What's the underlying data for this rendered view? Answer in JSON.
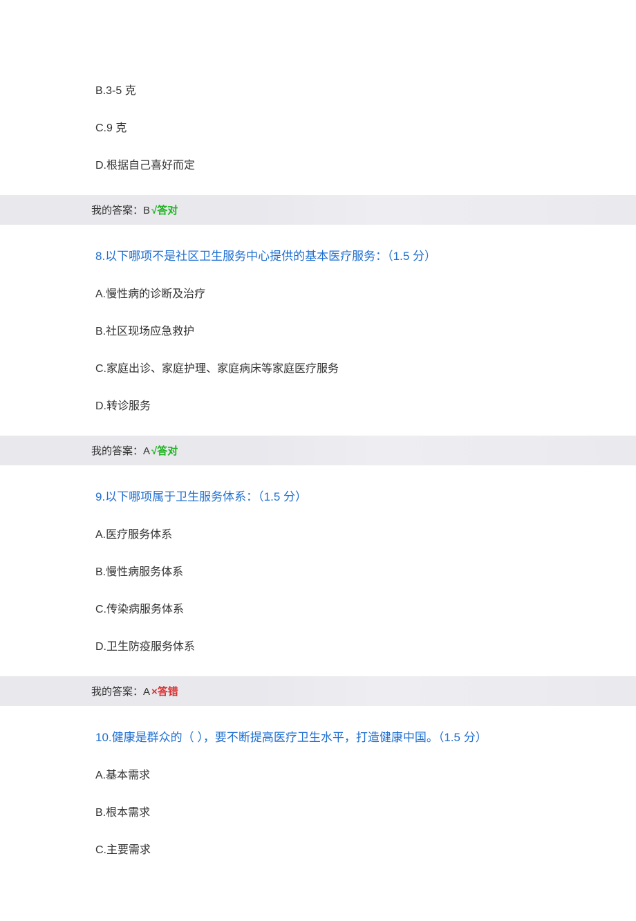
{
  "q7_partial": {
    "options": [
      {
        "label": "B.3-5 克"
      },
      {
        "label": "C.9 克"
      },
      {
        "label": "D.根据自己喜好而定"
      }
    ],
    "answer_prefix": "我的答案：B ",
    "answer_mark": "√答对"
  },
  "q8": {
    "title": "8.以下哪项不是社区卫生服务中心提供的基本医疗服务：（1.5 分）",
    "options": [
      {
        "label": "A.慢性病的诊断及治疗"
      },
      {
        "label": "B.社区现场应急救护"
      },
      {
        "label": "C.家庭出诊、家庭护理、家庭病床等家庭医疗服务"
      },
      {
        "label": "D.转诊服务"
      }
    ],
    "answer_prefix": "我的答案：A ",
    "answer_mark": "√答对"
  },
  "q9": {
    "title": "9.以下哪项属于卫生服务体系：（1.5 分）",
    "options": [
      {
        "label": "A.医疗服务体系"
      },
      {
        "label": "B.慢性病服务体系"
      },
      {
        "label": "C.传染病服务体系"
      },
      {
        "label": "D.卫生防疫服务体系"
      }
    ],
    "answer_prefix": "我的答案：A ",
    "answer_mark": "×答错"
  },
  "q10": {
    "title": "10.健康是群众的（   ），要不断提高医疗卫生水平，打造健康中国。（1.5 分）",
    "options": [
      {
        "label": "A.基本需求"
      },
      {
        "label": "B.根本需求"
      },
      {
        "label": "C.主要需求"
      }
    ]
  }
}
